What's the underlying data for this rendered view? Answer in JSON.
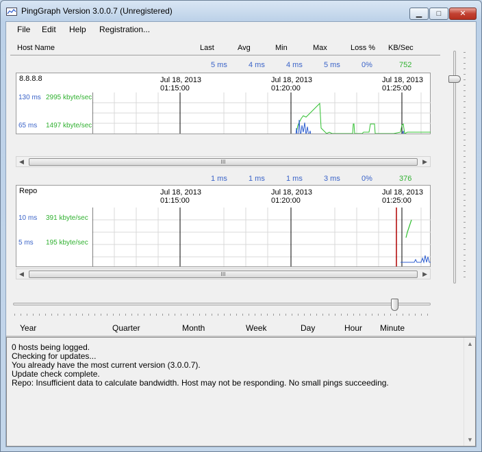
{
  "window": {
    "title": "PingGraph Version 3.0.0.7 (Unregistered)",
    "minimize_label": "▁",
    "maximize_label": "□",
    "close_label": "✕"
  },
  "menu": [
    "File",
    "Edit",
    "Help",
    "Registration..."
  ],
  "columns": {
    "host_name": "Host Name",
    "last": "Last",
    "avg": "Avg",
    "min": "Min",
    "max": "Max",
    "loss": "Loss %",
    "kbsec": "KB/Sec"
  },
  "hosts": [
    {
      "name": "8.8.8.8",
      "last": "5 ms",
      "avg": "4 ms",
      "min": "4 ms",
      "max": "5 ms",
      "loss": "0%",
      "kbsec": "752",
      "axis": {
        "ms_high": "130 ms",
        "kb_high": "2995 kbyte/sec",
        "ms_mid": "65 ms",
        "kb_mid": "1497 kbyte/sec"
      }
    },
    {
      "name": "Repo",
      "last": "1 ms",
      "avg": "1 ms",
      "min": "1 ms",
      "max": "3 ms",
      "loss": "0%",
      "kbsec": "376",
      "axis": {
        "ms_high": "10 ms",
        "kb_high": "391 kbyte/sec",
        "ms_mid": "5 ms",
        "kb_mid": "195 kbyte/sec"
      }
    }
  ],
  "time_labels": [
    {
      "date": "Jul 18, 2013",
      "time": "01:15:00"
    },
    {
      "date": "Jul 18, 2013",
      "time": "01:20:00"
    },
    {
      "date": "Jul 18, 2013",
      "time": "01:25:00"
    }
  ],
  "scrollbar": {
    "grip": "III",
    "left_arrow": "◀",
    "right_arrow": "▶",
    "up_arrow": "▲",
    "down_arrow": "▼"
  },
  "zoom_levels": [
    "Year",
    "Quarter",
    "Month",
    "Week",
    "Day",
    "Hour",
    "Minute"
  ],
  "zoom_selected": "Minute",
  "log": [
    "0 hosts being logged.",
    "Checking for updates...",
    "You already have the most current version (3.0.0.7).",
    "Update check complete.",
    "Repo: Insufficient data to calculate bandwidth. Host may not be responding. No small pings succeeding."
  ],
  "colors": {
    "ping": "#2f5fd0",
    "bandwidth": "#2ebf2e",
    "marker": "#b00000"
  }
}
